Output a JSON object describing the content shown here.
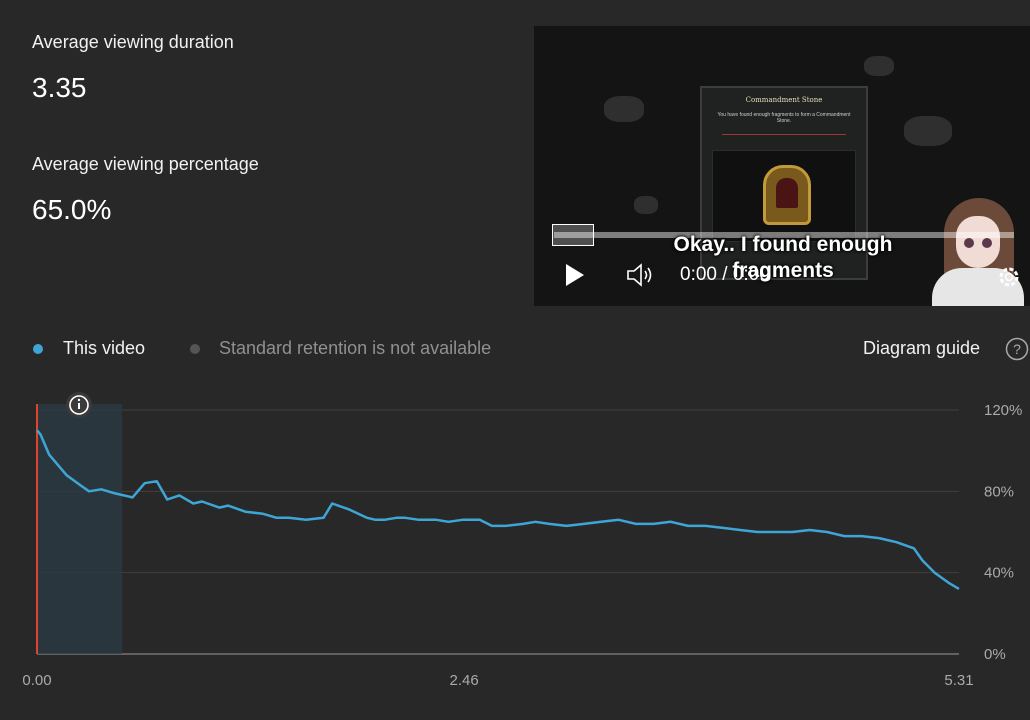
{
  "stats": {
    "avg_duration_label": "Average viewing duration",
    "avg_duration_value": "3.35",
    "avg_percentage_label": "Average viewing percentage",
    "avg_percentage_value": "65.0%"
  },
  "player": {
    "game_title": "Commandment Stone",
    "game_subtitle": "You have found enough fragments to form a Commandment Stone.",
    "caption": "Okay.. I found enough fragments",
    "time": "0:00 / 0:00",
    "progress": 0.0
  },
  "legend": {
    "this_video": "This video",
    "standard": "Standard retention is not available",
    "guide": "Diagram guide"
  },
  "colors": {
    "line": "#3ea6d6",
    "highlight": "#2b3b44",
    "marker": "#e0442c",
    "grid": "#3f3f3f",
    "muted": "#909090"
  },
  "chart_data": {
    "type": "line",
    "xlabel": "",
    "ylabel": "",
    "x_ticks": [
      "0.00",
      "2.46",
      "5.31"
    ],
    "y_ticks": [
      "120%",
      "80%",
      "40%",
      "0%"
    ],
    "xlim": [
      0,
      5.31
    ],
    "ylim": [
      0,
      120
    ],
    "series": [
      {
        "name": "This video",
        "x": [
          0,
          0.02,
          0.07,
          0.17,
          0.25,
          0.3,
          0.37,
          0.45,
          0.5,
          0.55,
          0.62,
          0.69,
          0.75,
          0.82,
          0.9,
          0.95,
          1.05,
          1.1,
          1.2,
          1.3,
          1.38,
          1.45,
          1.55,
          1.65,
          1.7,
          1.8,
          1.9,
          1.95,
          2.0,
          2.07,
          2.12,
          2.2,
          2.3,
          2.37,
          2.45,
          2.55,
          2.62,
          2.7,
          2.8,
          2.87,
          2.95,
          3.05,
          3.15,
          3.25,
          3.35,
          3.45,
          3.55,
          3.65,
          3.75,
          3.85,
          3.95,
          4.05,
          4.15,
          4.25,
          4.35,
          4.45,
          4.55,
          4.65,
          4.75,
          4.85,
          4.95,
          5.05,
          5.1,
          5.17,
          5.25,
          5.31
        ],
        "values": [
          110,
          108,
          98,
          88,
          83,
          80,
          81,
          79,
          78,
          77,
          84,
          85,
          76,
          78,
          74,
          75,
          72,
          73,
          70,
          69,
          67,
          67,
          66,
          67,
          74,
          71,
          67,
          66,
          66,
          67,
          67,
          66,
          66,
          65,
          66,
          66,
          63,
          63,
          64,
          65,
          64,
          63,
          64,
          65,
          66,
          64,
          64,
          65,
          63,
          63,
          62,
          61,
          60,
          60,
          60,
          61,
          60,
          58,
          58,
          57,
          55,
          52,
          46,
          40,
          35,
          32
        ]
      }
    ],
    "grid": true,
    "legend": "top-left",
    "highlight_range": [
      0,
      0.49
    ]
  }
}
